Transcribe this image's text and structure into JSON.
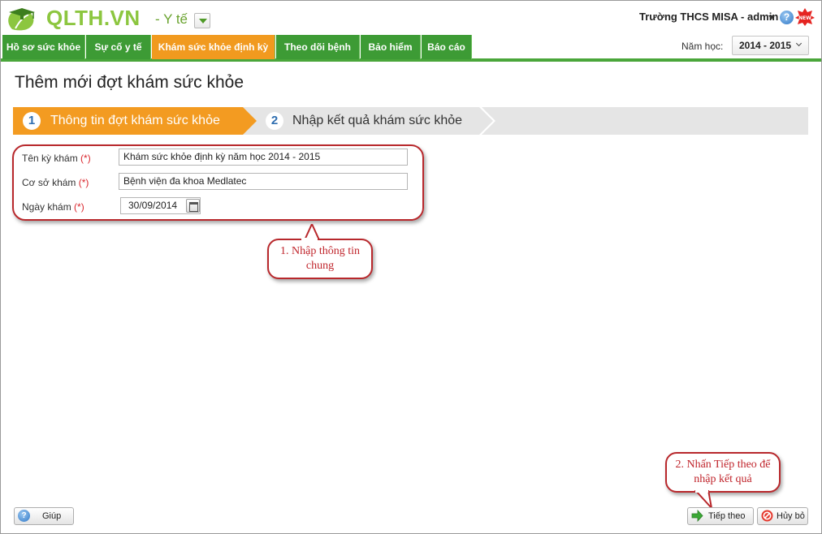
{
  "header": {
    "brand": "QLTH.VN",
    "module": "- Y tế",
    "school_user": "Trường THCS MISA - admin"
  },
  "nav": {
    "tabs": [
      {
        "label": "Hồ sơ sức khỏe"
      },
      {
        "label": "Sự cố y tế"
      },
      {
        "label": "Khám sức khỏe định kỳ"
      },
      {
        "label": "Theo dõi bệnh"
      },
      {
        "label": "Bảo hiểm"
      },
      {
        "label": "Báo cáo"
      }
    ],
    "active_tab": "Khám sức khỏe định kỳ",
    "year_label": "Năm học:",
    "year_value": "2014 - 2015"
  },
  "page": {
    "title": "Thêm mới đợt khám sức khỏe"
  },
  "wizard": {
    "steps": [
      {
        "number": "1",
        "label": "Thông tin đợt khám sức khỏe"
      },
      {
        "number": "2",
        "label": "Nhập kết quả khám sức khỏe"
      }
    ]
  },
  "form": {
    "required_mark": "(*)",
    "name_label": "Tên kỳ khám",
    "name_value": "Khám sức khỏe định kỳ năm học 2014 - 2015",
    "facility_label": "Cơ sở khám",
    "facility_value": "Bệnh viện đa khoa Medlatec",
    "date_label": "Ngày khám",
    "date_value": "30/09/2014"
  },
  "annotations": {
    "callout1_line1": "1. Nhập thông tin",
    "callout1_line2": "chung",
    "callout2_line1": "2. Nhấn Tiếp theo để",
    "callout2_line2": "nhập kết quả"
  },
  "footer": {
    "help_label": "Giúp",
    "next_label": "Tiếp theo",
    "cancel_label": "Hủy bỏ"
  },
  "colors": {
    "brand_green": "#8cc63f",
    "nav_green": "#3d9b35",
    "active_orange": "#f19a1f",
    "callout_red": "#b8282c"
  },
  "icons": [
    "leaf-logo-icon",
    "dropdown-arrow-icon",
    "help-icon",
    "new-badge-icon",
    "calendar-icon",
    "arrow-right-icon",
    "cancel-icon",
    "help-circle-icon"
  ]
}
